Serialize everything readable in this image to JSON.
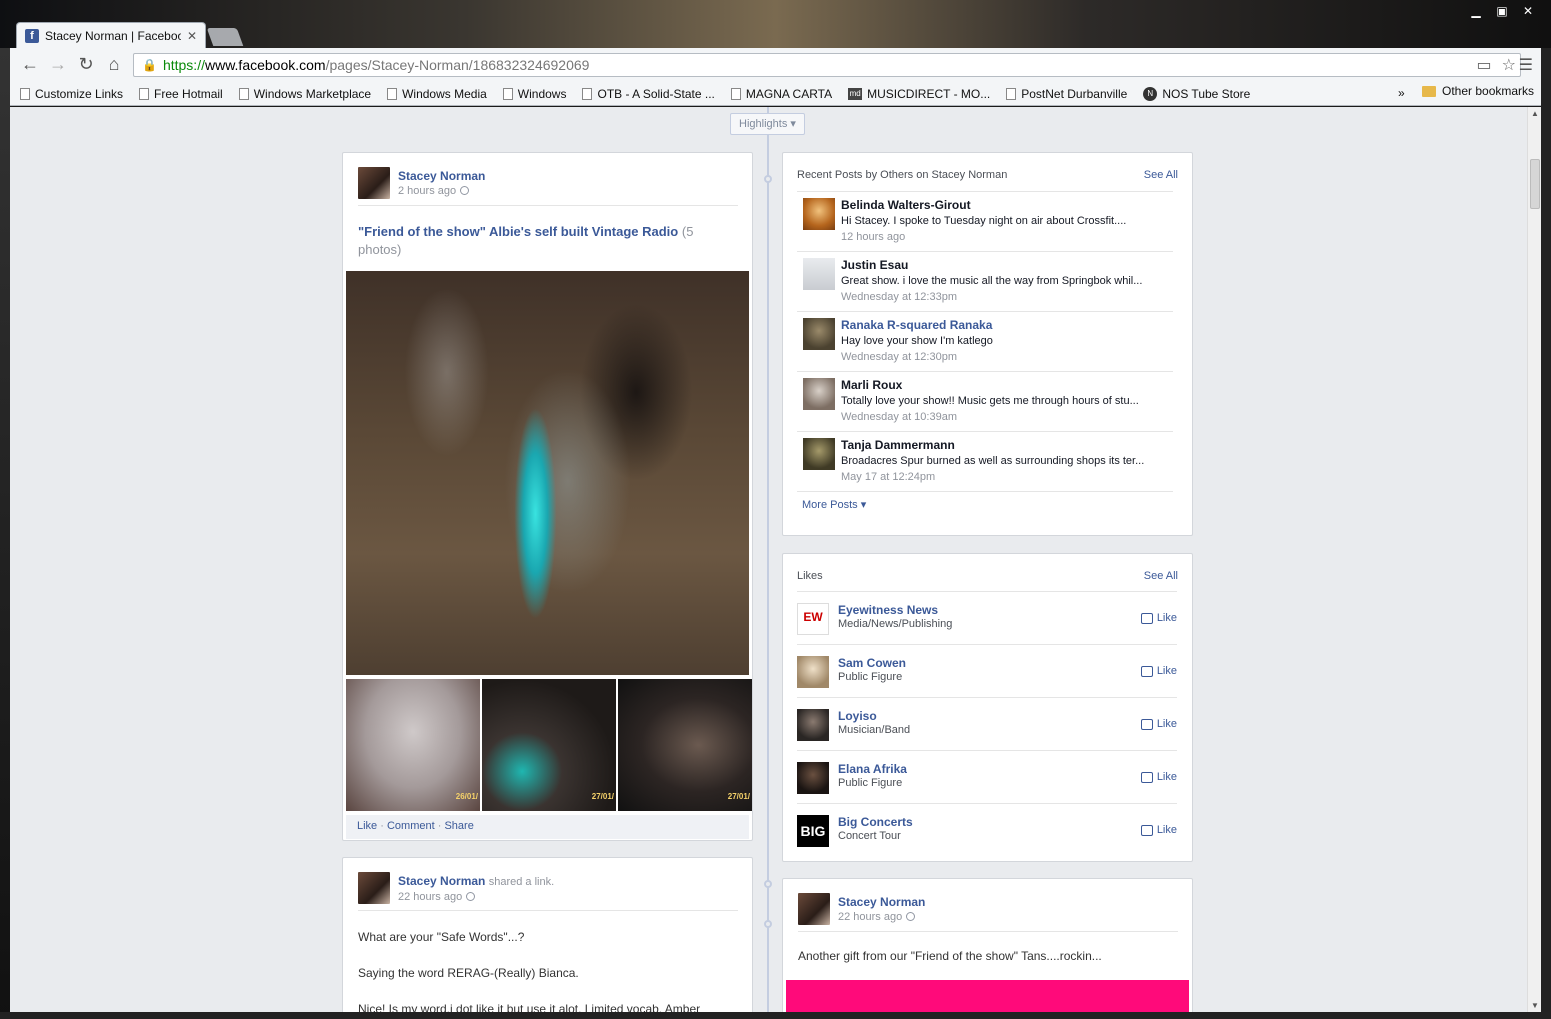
{
  "browser": {
    "tab_title": "Stacey Norman | Facebook",
    "url_https": "https://",
    "url_host": "www.facebook.com",
    "url_path": "/pages/Stacey-Norman/186832324692069",
    "bookmarks": [
      "Customize Links",
      "Free Hotmail",
      "Windows Marketplace",
      "Windows Media",
      "Windows",
      "OTB - A Solid-State ...",
      "MAGNA CARTA",
      "MUSICDIRECT - MO...",
      "PostNet Durbanville",
      "NOS Tube Store"
    ],
    "bookmarks_more": "»",
    "other_bookmarks": "Other bookmarks"
  },
  "timeline": {
    "highlights_label": "Highlights"
  },
  "post1": {
    "author": "Stacey Norman",
    "time": "2 hours ago",
    "title": "\"Friend of the show\" Albie's self built Vintage Radio",
    "photo_count": "(5 photos)",
    "thumb_dates": [
      "26/01/",
      "27/01/",
      "27/01/"
    ],
    "like": "Like",
    "comment": "Comment",
    "share": "Share",
    "sep": "·"
  },
  "post2": {
    "author": "Stacey Norman",
    "action": "shared a link.",
    "time": "22 hours ago",
    "lines": [
      "What are your \"Safe Words\"...?",
      "Saying the word RERAG-(Really) Bianca.",
      "Nice! Is my word.i dot like it but use it alot. Limited vocab. Amber"
    ]
  },
  "recent_posts": {
    "heading": "Recent Posts by Others on Stacey Norman",
    "see_all": "See All",
    "items": [
      {
        "name": "Belinda Walters-Girout",
        "text": "Hi Stacey. I spoke to Tuesday night on air about Crossfit....",
        "time": "12 hours ago"
      },
      {
        "name": "Justin Esau",
        "text": "Great show. i love the music all the way from Springbok whil...",
        "time": "Wednesday at 12:33pm"
      },
      {
        "name": "Ranaka R-squared Ranaka",
        "text": "Hay love your show I'm katlego",
        "time": "Wednesday at 12:30pm"
      },
      {
        "name": "Marli Roux",
        "text": "Totally love your show!! Music gets me through hours of stu...",
        "time": "Wednesday at 10:39am"
      },
      {
        "name": "Tanja Dammermann",
        "text": "Broadacres Spur burned as well as surrounding shops its ter...",
        "time": "May 17 at 12:24pm"
      }
    ],
    "more_posts": "More Posts"
  },
  "likes": {
    "heading": "Likes",
    "see_all": "See All",
    "like_label": "Like",
    "items": [
      {
        "name": "Eyewitness News",
        "category": "Media/News/Publishing"
      },
      {
        "name": "Sam Cowen",
        "category": "Public Figure"
      },
      {
        "name": "Loyiso",
        "category": "Musician/Band"
      },
      {
        "name": "Elana Afrika",
        "category": "Public Figure"
      },
      {
        "name": "Big Concerts",
        "category": "Concert Tour"
      }
    ]
  },
  "post3": {
    "author": "Stacey Norman",
    "time": "22 hours ago",
    "text": "Another gift from our \"Friend of the show\" Tans....rockin..."
  }
}
